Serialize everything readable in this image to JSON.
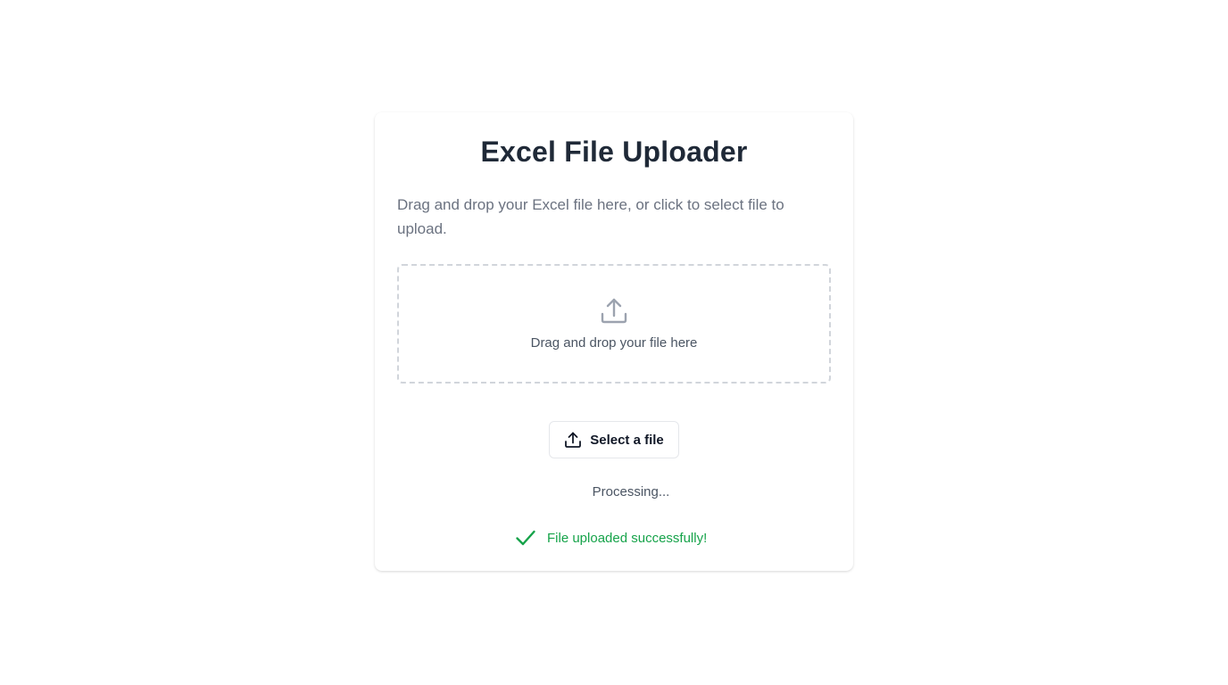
{
  "uploader": {
    "title": "Excel File Uploader",
    "description": "Drag and drop your Excel file here, or click to select file to upload.",
    "dropzone_text": "Drag and drop your file here",
    "select_button_label": "Select a file",
    "processing_text": "Processing...",
    "success_text": "File uploaded successfully!"
  },
  "icons": {
    "dropzone": "upload-icon",
    "button": "upload-icon",
    "success": "checkmark-icon"
  },
  "colors": {
    "title": "#1f2937",
    "muted_text": "#6b7280",
    "dropzone_border": "#d1d5db",
    "success": "#16a34a"
  }
}
